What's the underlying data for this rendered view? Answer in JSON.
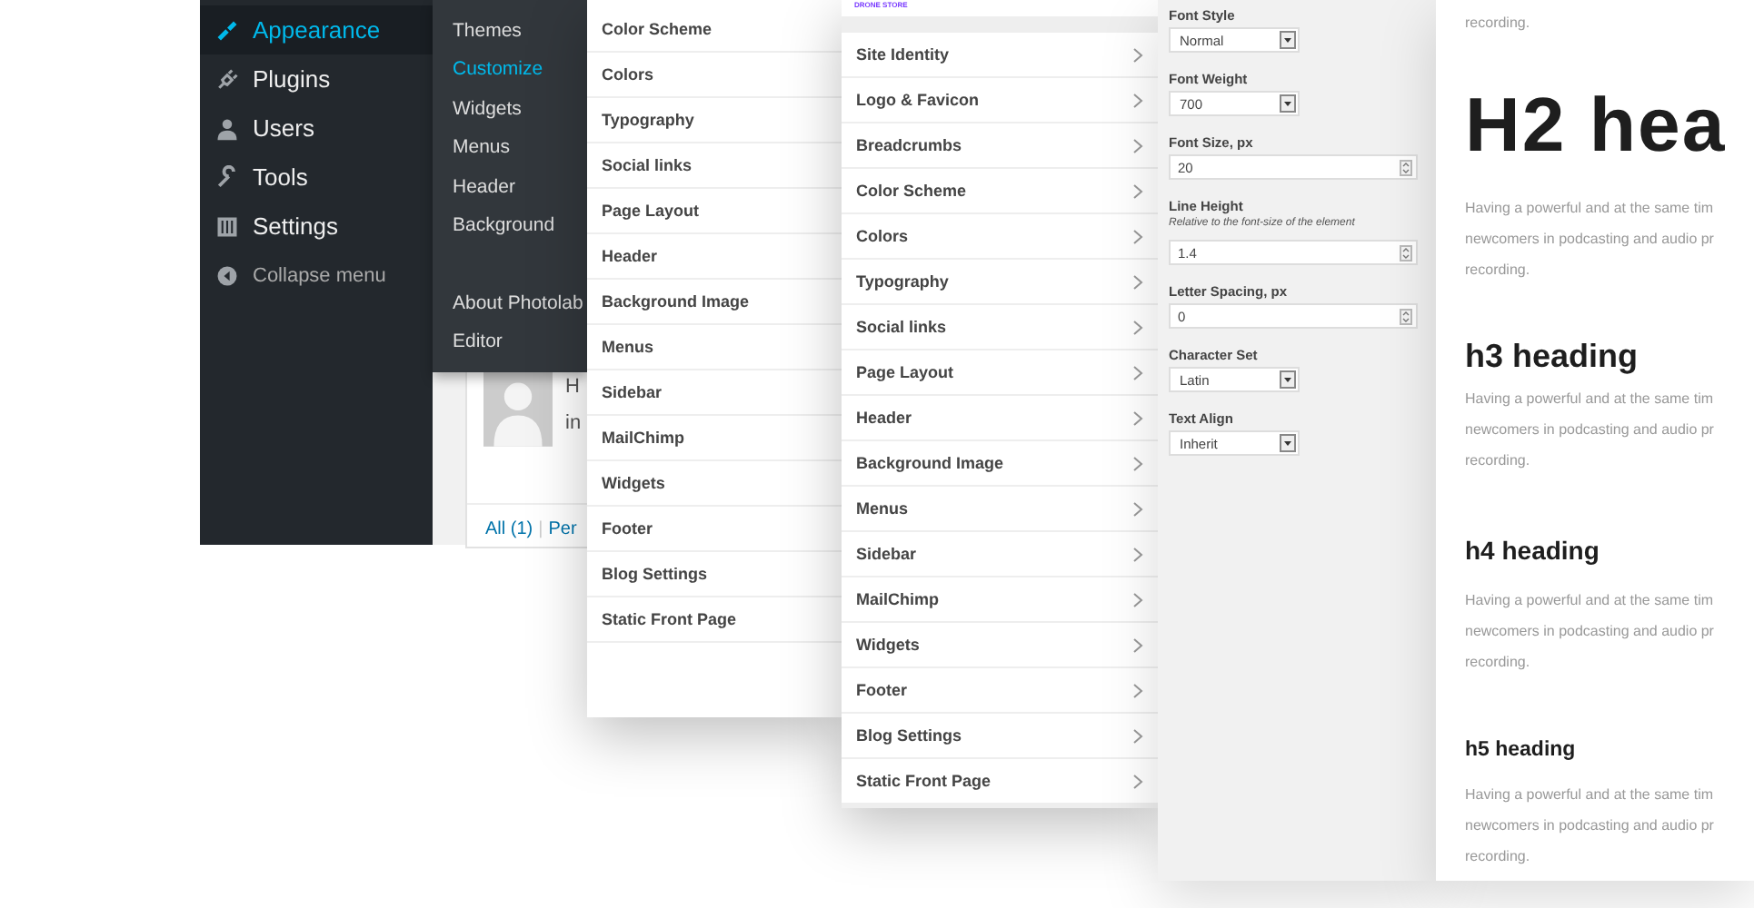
{
  "admin_menu": {
    "items": [
      {
        "label": "Appearance",
        "selected": true
      },
      {
        "label": "Plugins",
        "selected": false
      },
      {
        "label": "Users",
        "selected": false
      },
      {
        "label": "Tools",
        "selected": false
      },
      {
        "label": "Settings",
        "selected": false
      },
      {
        "label": "Collapse menu",
        "selected": false
      }
    ]
  },
  "appearance_submenu": {
    "groups": [
      [
        {
          "label": "Themes",
          "selected": false
        },
        {
          "label": "Customize",
          "selected": true
        },
        {
          "label": "Widgets",
          "selected": false
        },
        {
          "label": "Menus",
          "selected": false
        },
        {
          "label": "Header",
          "selected": false
        },
        {
          "label": "Background",
          "selected": false
        }
      ],
      [
        {
          "label": "About Photolab",
          "selected": false
        },
        {
          "label": "Editor",
          "selected": false
        }
      ]
    ]
  },
  "comments_card": {
    "text_lines": [
      "H",
      "in"
    ],
    "filter_links": [
      "All (1)",
      "Per"
    ],
    "separator": "|"
  },
  "customizer_menu_back": {
    "items": [
      "Color Scheme",
      "Colors",
      "Typography",
      "Social links",
      "Page Layout",
      "Header",
      "Background Image",
      "Menus",
      "Sidebar",
      "MailChimp",
      "Widgets",
      "Footer",
      "Blog Settings",
      "Static Front Page"
    ]
  },
  "customizer_menu": {
    "logo": "DRONE STORE",
    "items": [
      "Site Identity",
      "Logo & Favicon",
      "Breadcrumbs",
      "Color Scheme",
      "Colors",
      "Typography",
      "Social links",
      "Page Layout",
      "Header",
      "Background Image",
      "Menus",
      "Sidebar",
      "MailChimp",
      "Widgets",
      "Footer",
      "Blog Settings",
      "Static Front Page"
    ]
  },
  "typography_settings": {
    "fields": [
      {
        "label": "Font Style",
        "kind": "select",
        "value": "Normal"
      },
      {
        "label": "Font Weight",
        "kind": "select",
        "value": "700"
      },
      {
        "label": "Font Size, px",
        "kind": "number",
        "value": "20"
      },
      {
        "label": "Line Height",
        "hint": "Relative to the font-size of the element",
        "kind": "number",
        "value": "1.4"
      },
      {
        "label": "Letter Spacing, px",
        "kind": "number",
        "value": "0"
      },
      {
        "label": "Character Set",
        "kind": "select",
        "value": "Latin"
      },
      {
        "label": "Text Align",
        "kind": "select",
        "value": "Inherit"
      }
    ]
  },
  "preview": {
    "blocks": [
      {
        "kind": "paragraph",
        "lines": [
          "recording."
        ]
      },
      {
        "kind": "h2",
        "text": "H2 hea"
      },
      {
        "kind": "paragraph",
        "lines": [
          "Having a powerful and at the same tim",
          "newcomers in podcasting and audio pr",
          "recording."
        ]
      },
      {
        "kind": "h3",
        "text": "h3 heading"
      },
      {
        "kind": "paragraph",
        "lines": [
          "Having a powerful and at the same tim",
          "newcomers in podcasting and audio pr",
          "recording."
        ]
      },
      {
        "kind": "h4",
        "text": "h4 heading"
      },
      {
        "kind": "paragraph",
        "lines": [
          "Having a powerful and at the same tim",
          "newcomers in podcasting and audio pr",
          "recording."
        ]
      },
      {
        "kind": "h5",
        "text": "h5 heading"
      },
      {
        "kind": "paragraph",
        "lines": [
          "Having a powerful and at the same tim",
          "newcomers in podcasting and audio pr",
          "recording."
        ]
      }
    ]
  }
}
